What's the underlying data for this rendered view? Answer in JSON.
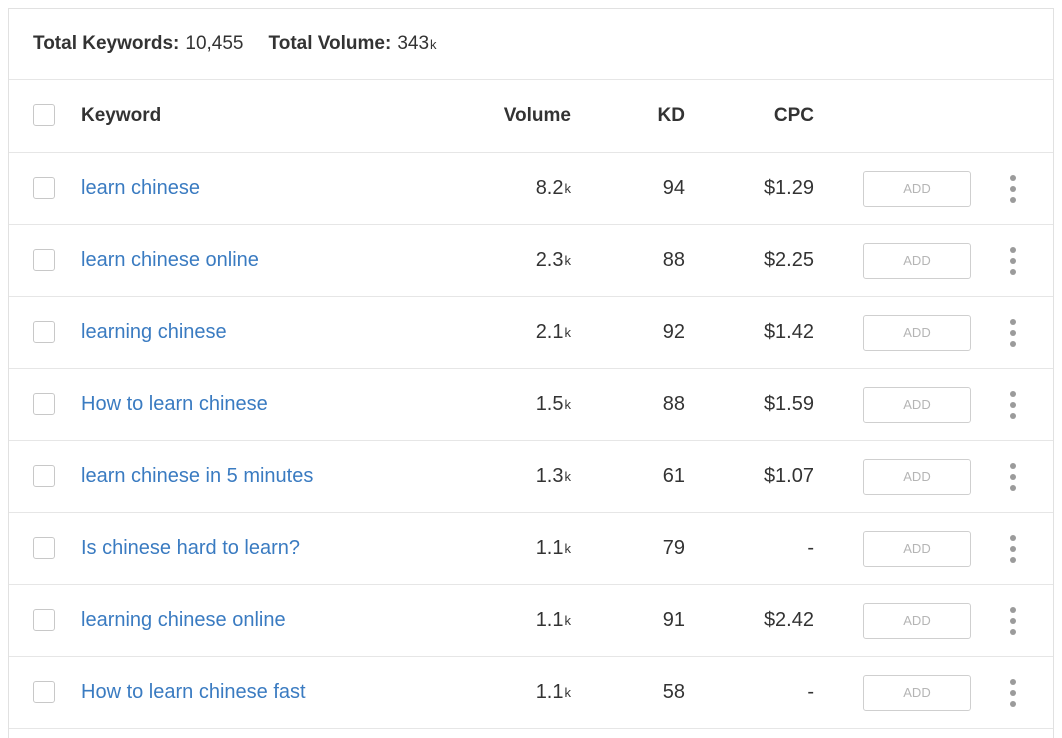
{
  "summary": {
    "total_keywords_label": "Total Keywords:",
    "total_keywords_value": "10,455",
    "total_volume_label": "Total Volume:",
    "total_volume_value": "343",
    "total_volume_unit": "k"
  },
  "table": {
    "columns": {
      "keyword": "Keyword",
      "volume": "Volume",
      "kd": "KD",
      "cpc": "CPC"
    },
    "add_label": "ADD",
    "rows": [
      {
        "keyword": "learn chinese",
        "volume": "8.2",
        "unit": "k",
        "kd": "94",
        "cpc": "$1.29"
      },
      {
        "keyword": "learn chinese online",
        "volume": "2.3",
        "unit": "k",
        "kd": "88",
        "cpc": "$2.25"
      },
      {
        "keyword": "learning chinese",
        "volume": "2.1",
        "unit": "k",
        "kd": "92",
        "cpc": "$1.42"
      },
      {
        "keyword": "How to learn chinese",
        "volume": "1.5",
        "unit": "k",
        "kd": "88",
        "cpc": "$1.59"
      },
      {
        "keyword": "learn chinese in 5 minutes",
        "volume": "1.3",
        "unit": "k",
        "kd": "61",
        "cpc": "$1.07"
      },
      {
        "keyword": "Is chinese hard to learn?",
        "volume": "1.1",
        "unit": "k",
        "kd": "79",
        "cpc": "-"
      },
      {
        "keyword": "learning chinese online",
        "volume": "1.1",
        "unit": "k",
        "kd": "91",
        "cpc": "$2.42"
      },
      {
        "keyword": "How to learn chinese fast",
        "volume": "1.1",
        "unit": "k",
        "kd": "58",
        "cpc": "-"
      }
    ]
  },
  "colors": {
    "link": "#3a7bc1",
    "text": "#333333",
    "border": "#e6e6e6",
    "muted": "#b5b5b5"
  },
  "icons": {
    "row_menu": "more-vertical-icon",
    "checkbox": "checkbox-icon"
  }
}
